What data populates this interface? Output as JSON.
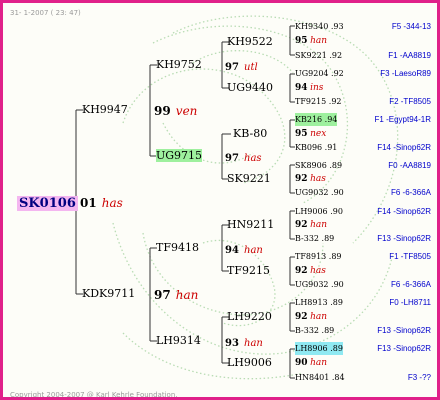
{
  "header": "31- 1-2007 ( 23: 47)",
  "copyright": "Copyright 2004-2007 @ Karl Kehrle Foundation.",
  "colors": {
    "border": "#e0218a",
    "root_bg": "#f4b6f0",
    "green_hl": "#9ef09e",
    "cyan_hl": "#8fe9f2",
    "tag": "#cc0000",
    "location": "#0000cc"
  },
  "root": {
    "name": "SK0106",
    "num": "01",
    "tag": "has"
  },
  "gen1": [
    {
      "name": "KH9947",
      "num": "99",
      "tag": "ven"
    },
    {
      "name": "KDK9711",
      "num": "97",
      "tag": "han"
    }
  ],
  "gen2": [
    {
      "name": "KH9752",
      "num": "97",
      "tag": "utl"
    },
    {
      "name": "UG9715",
      "num": "97",
      "tag": "has",
      "highlight": "green"
    },
    {
      "name": "TF9418",
      "num": "94",
      "tag": "han"
    },
    {
      "name": "LH9314",
      "num": "93",
      "tag": "han"
    }
  ],
  "gen3": [
    {
      "name": "KH9522",
      "num": "95",
      "tag": "han"
    },
    {
      "name": "UG9440",
      "num": "94",
      "tag": "ins"
    },
    {
      "name": "KB-80",
      "num": "95",
      "tag": "nex"
    },
    {
      "name": "SK9221",
      "num": "92",
      "tag": "has"
    },
    {
      "name": "HN9211",
      "num": "92",
      "tag": "han"
    },
    {
      "name": "TF9215",
      "num": "92",
      "tag": "has"
    },
    {
      "name": "LH9220",
      "num": "92",
      "tag": "han"
    },
    {
      "name": "LH9006",
      "num": "90",
      "tag": "han"
    }
  ],
  "leaves": [
    {
      "name": "KH9340 .93",
      "location": "F5 -344-13"
    },
    {
      "name": "SK9221 .92",
      "location": "F1 -AA8819"
    },
    {
      "name": "UG9204 .92",
      "location": "F3 -LaesoR89"
    },
    {
      "name": "TF9215 .92",
      "location": "F2 -TF8505"
    },
    {
      "name": "KB216 .94",
      "location": "F1 -Egypt94-1R",
      "highlight": "green"
    },
    {
      "name": "KB096 .91",
      "location": "F14 -Sinop62R"
    },
    {
      "name": "SK8906 .89",
      "location": "F0 -AA8819"
    },
    {
      "name": "UG9032 .90",
      "location": "F6 -6-366A"
    },
    {
      "name": "LH9006 .90",
      "location": "F14 -Sinop62R"
    },
    {
      "name": "B-332 .89",
      "location": "F13 -Sinop62R"
    },
    {
      "name": "TF8913 .89",
      "location": "F1 -TF8505"
    },
    {
      "name": "UG9032 .90",
      "location": "F6 -6-366A"
    },
    {
      "name": "LH8913 .89",
      "location": "F0 -LH8711"
    },
    {
      "name": "B-332 .89",
      "location": "F13 -Sinop62R"
    },
    {
      "name": "LH8906 .89",
      "location": "F13 -Sinop62R",
      "highlight": "cyan"
    },
    {
      "name": "HN8401 .84",
      "location": "F3 -??"
    }
  ]
}
